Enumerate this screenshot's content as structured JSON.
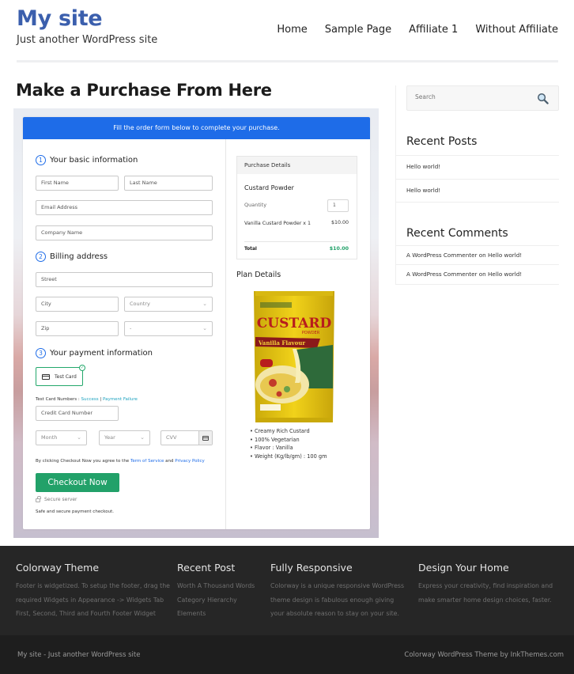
{
  "header": {
    "site_title": "My site",
    "tagline": "Just another WordPress site",
    "nav": [
      "Home",
      "Sample Page",
      "Affiliate 1",
      "Without Affiliate"
    ]
  },
  "page": {
    "title": "Make a Purchase From Here"
  },
  "checkout": {
    "banner": "Fill the order form below to complete your purchase.",
    "steps": [
      {
        "num": "1",
        "label": "Your basic information"
      },
      {
        "num": "2",
        "label": "Billing address"
      },
      {
        "num": "3",
        "label": "Your payment information"
      }
    ],
    "fields": {
      "first_name": "First Name",
      "last_name": "Last Name",
      "email": "Email Address",
      "company": "Company Name",
      "street": "Street",
      "city": "City",
      "country": "Country",
      "zip": "Zip",
      "state": "-",
      "card_number": "Credit Card Number",
      "month": "Month",
      "year": "Year",
      "cvv": "CVV"
    },
    "payment_method": "Test Card",
    "test_numbers_label": "Test Card Numbers : ",
    "success_link": "Success",
    "separator": " | ",
    "failure_link": "Payment Failure",
    "agree_prefix": "By clicking Checkout Now you agree to the ",
    "terms_link": "Term of Service",
    "agree_and": " and ",
    "privacy_link": "Privacy Policy",
    "checkout_button": "Checkout Now",
    "secure_label": "Secure server",
    "safe_text": "Safe and secure payment checkout."
  },
  "purchase": {
    "heading": "Purchase Details",
    "product": "Custard Powder",
    "quantity_label": "Quantity",
    "quantity": "1",
    "item": "Vanilla Custard Powder x 1",
    "item_price": "$10.00",
    "total_label": "Total",
    "total": "$10.00",
    "total_color": "#22a169"
  },
  "plan": {
    "title": "Plan Details",
    "image_alt": "Custard Powder Vanilla Flavour package",
    "pack_brand": "CUSTARD",
    "pack_sub": "POWDER",
    "pack_flavor": "Vanilla Flavour",
    "features": [
      "Creamy Rich Custard",
      "100% Vegetarian",
      "Flavor : Vanilla",
      "Weight (Kg/lb/gm) : 100 gm"
    ]
  },
  "sidebar": {
    "search_placeholder": "Search",
    "recent_posts_title": "Recent Posts",
    "recent_posts": [
      "Hello world!",
      "Hello world!"
    ],
    "recent_comments_title": "Recent Comments",
    "recent_comments": [
      {
        "author": "A WordPress Commenter",
        "on": " on ",
        "post": "Hello world!"
      },
      {
        "author": "A WordPress Commenter",
        "on": " on ",
        "post": "Hello world!"
      }
    ]
  },
  "footer": {
    "columns": [
      {
        "title": "Colorway Theme",
        "text": "Footer is widgetized. To setup the footer, drag the required Widgets in Appearance -> Widgets Tab First, Second, Third and Fourth Footer Widget"
      },
      {
        "title": "Recent Post",
        "links": [
          "Worth A Thousand Words",
          "Category Hierarchy",
          "Elements"
        ]
      },
      {
        "title": "Fully Responsive",
        "text": "Colorway is a unique responsive WordPress theme design is fabulous enough giving your absolute reason to stay on your site."
      },
      {
        "title": "Design Your Home",
        "text": "Express your creativity, find inspiration and make smarter home design choices, faster."
      }
    ],
    "bottom_left": "My site - Just another WordPress site",
    "bottom_right": "Colorway WordPress Theme by InkThemes.com"
  },
  "colors": {
    "brand_blue": "#3b5fad",
    "banner_blue": "#1e6ce8",
    "checkout_green": "#22a169",
    "footer_bg": "#262626"
  }
}
